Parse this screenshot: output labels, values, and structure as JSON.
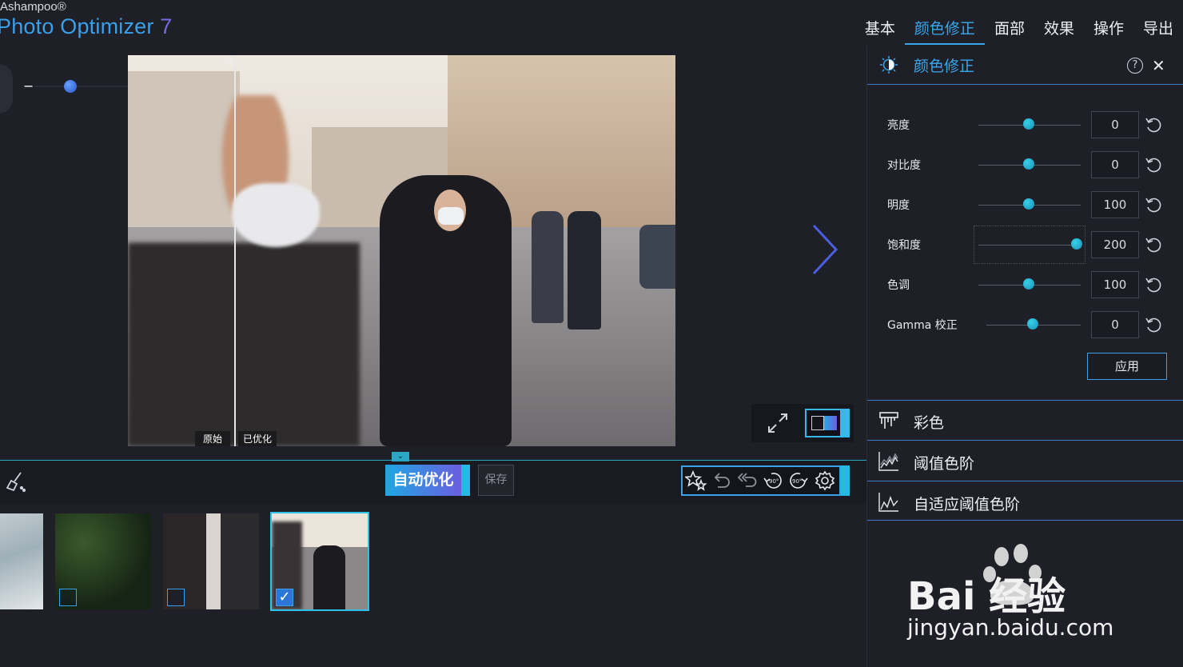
{
  "app": {
    "brand_small": "Ashampoo®",
    "brand_title": "Photo Optimizer",
    "version": "7"
  },
  "topnav": [
    {
      "label": "基本",
      "active": false
    },
    {
      "label": "颜色修正",
      "active": true
    },
    {
      "label": "面部",
      "active": false
    },
    {
      "label": "效果",
      "active": false
    },
    {
      "label": "操作",
      "active": false
    },
    {
      "label": "导出",
      "active": false
    }
  ],
  "zoom": {
    "minus": "−",
    "plus": "+"
  },
  "compare": {
    "original_label": "原始",
    "optimized_label": "已优化"
  },
  "toolbar": {
    "auto_optimize": "自动优化",
    "save": "保存",
    "tool_icons": [
      "star-magic-icon",
      "undo-icon",
      "undo-all-icon",
      "rotate-left-90-icon",
      "rotate-right-90-icon",
      "settings-icon"
    ]
  },
  "thumbnails": [
    {
      "name": "snow-scene",
      "checked": null
    },
    {
      "name": "green-leaves",
      "checked": false
    },
    {
      "name": "couple-masks",
      "checked": false
    },
    {
      "name": "street-masks",
      "checked": true
    }
  ],
  "panel": {
    "title": "颜色修正",
    "help": "?",
    "close": "✕",
    "adjustments": [
      {
        "label": "亮度",
        "value": "0"
      },
      {
        "label": "对比度",
        "value": "0"
      },
      {
        "label": "明度",
        "value": "100"
      },
      {
        "label": "饱和度",
        "value": "200"
      },
      {
        "label": "色调",
        "value": "100"
      },
      {
        "label": "Gamma 校正",
        "value": "0"
      }
    ],
    "apply": "应用",
    "sections": [
      {
        "label": "彩色"
      },
      {
        "label": "阈值色阶"
      },
      {
        "label": "自适应阈值色阶"
      }
    ]
  },
  "watermark": {
    "line1": "Bai 经验",
    "line2": "jingyan.baidu.com"
  },
  "colors": {
    "accent": "#3aa7ec",
    "cyan": "#30c2e8",
    "bg": "#1e1f27"
  }
}
